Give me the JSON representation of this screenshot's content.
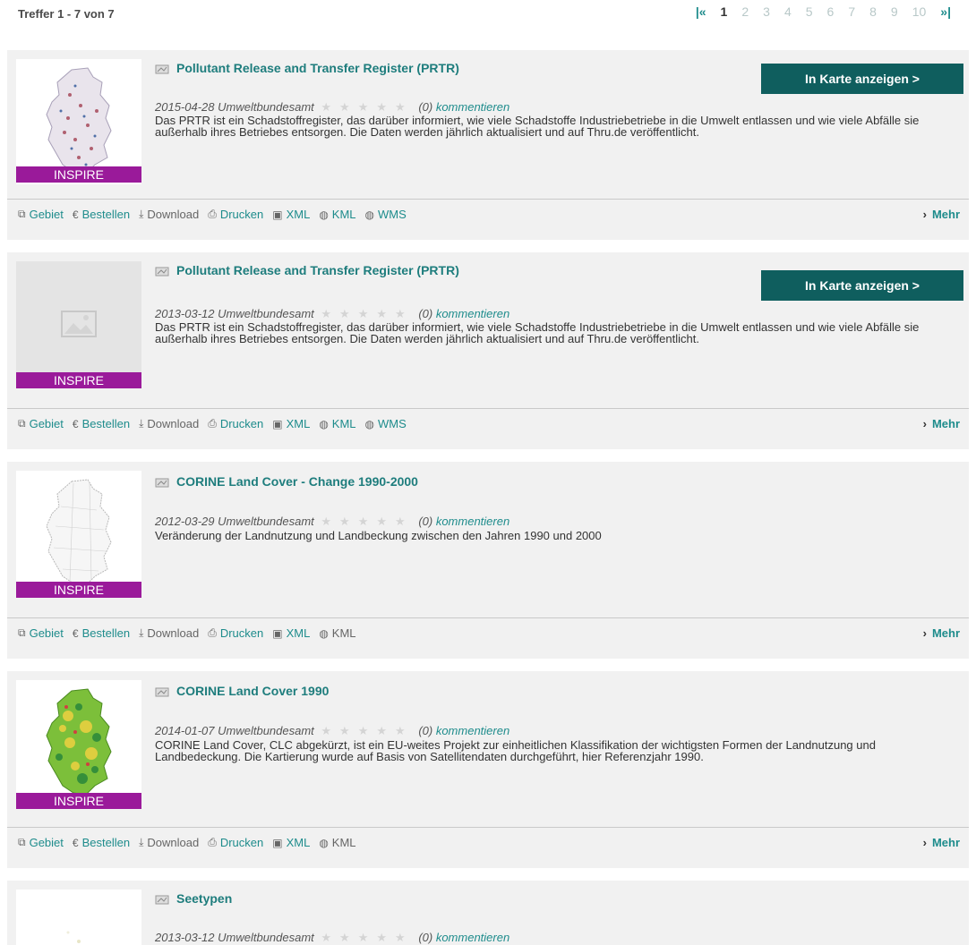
{
  "results_count": "Treffer 1 - 7 von 7",
  "pager": {
    "first": "|«",
    "pages": [
      "1",
      "2",
      "3",
      "4",
      "5",
      "6",
      "7",
      "8",
      "9",
      "10"
    ],
    "current": "1",
    "last": "»|"
  },
  "cards": [
    {
      "title": "Pollutant Release and Transfer Register (PRTR)",
      "map_button": "In Karte anzeigen >",
      "date": "2015-04-28",
      "source": "Umweltbundesamt",
      "stars": "★★★★★",
      "rating_count": "(0)",
      "comment": "kommentieren",
      "description": "Das PRTR ist ein Schadstoffregister, das darüber informiert, wie viele Schadstoffe Industriebetriebe in die Umwelt entlassen und wie viele Abfälle sie außerhalb ihres Betriebes entsorgen. Die Daten werden jährlich aktualisiert und auf Thru.de veröffentlicht.",
      "badge": "INSPIRE",
      "actions": [
        "Gebiet",
        "Bestellen",
        "Download",
        "Drucken",
        "XML",
        "KML",
        "WMS"
      ],
      "more": "Mehr"
    },
    {
      "title": "Pollutant Release and Transfer Register (PRTR)",
      "map_button": "In Karte anzeigen >",
      "date": "2013-03-12",
      "source": "Umweltbundesamt",
      "stars": "★★★★★",
      "rating_count": "(0)",
      "comment": "kommentieren",
      "description": "Das PRTR ist ein Schadstoffregister, das darüber informiert, wie viele Schadstoffe Industriebetriebe in die Umwelt entlassen und wie viele Abfälle sie außerhalb ihres Betriebes entsorgen. Die Daten werden jährlich aktualisiert und auf Thru.de veröffentlicht.",
      "badge": "INSPIRE",
      "actions": [
        "Gebiet",
        "Bestellen",
        "Download",
        "Drucken",
        "XML",
        "KML",
        "WMS"
      ],
      "more": "Mehr"
    },
    {
      "title": "CORINE Land Cover - Change 1990-2000",
      "date": "2012-03-29",
      "source": "Umweltbundesamt",
      "stars": "★★★★★",
      "rating_count": "(0)",
      "comment": "kommentieren",
      "description": "Veränderung der Landnutzung und Landbeckung zwischen den Jahren 1990 und 2000",
      "badge": "INSPIRE",
      "actions": [
        "Gebiet",
        "Bestellen",
        "Download",
        "Drucken",
        "XML",
        "KML"
      ],
      "more": "Mehr"
    },
    {
      "title": "CORINE Land Cover 1990",
      "date": "2014-01-07",
      "source": "Umweltbundesamt",
      "stars": "★★★★★",
      "rating_count": "(0)",
      "comment": "kommentieren",
      "description": "CORINE Land Cover, CLC abgekürzt, ist ein EU-weites Projekt zur einheitlichen Klassifikation der wichtigsten Formen der Landnutzung und Landbedeckung. Die Kartierung wurde auf Basis von Satellitendaten durchgeführt, hier Referenzjahr 1990.",
      "badge": "INSPIRE",
      "actions": [
        "Gebiet",
        "Bestellen",
        "Download",
        "Drucken",
        "XML",
        "KML"
      ],
      "more": "Mehr"
    },
    {
      "title": "Seetypen",
      "date": "2013-03-12",
      "source": "Umweltbundesamt",
      "stars": "★★★★★",
      "rating_count": "(0)",
      "comment": "kommentieren"
    }
  ],
  "colors": {
    "accent": "#1e8c8c",
    "button": "#0f5e5e",
    "badge": "#9a1a9a",
    "card_bg": "#f1f1f1"
  }
}
